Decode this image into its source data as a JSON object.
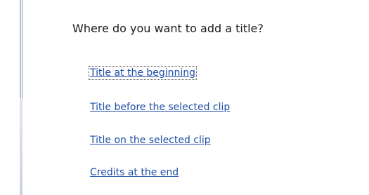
{
  "dialog": {
    "question": "Where do you want to add a title?",
    "options": [
      {
        "label": "Title at the beginning"
      },
      {
        "label": "Title before the selected clip"
      },
      {
        "label": "Title on the selected clip"
      },
      {
        "label": "Credits at the end"
      }
    ]
  },
  "colors": {
    "link": "#1f4fa8",
    "text": "#1a1a1a",
    "frame": "#b4c1d2"
  }
}
